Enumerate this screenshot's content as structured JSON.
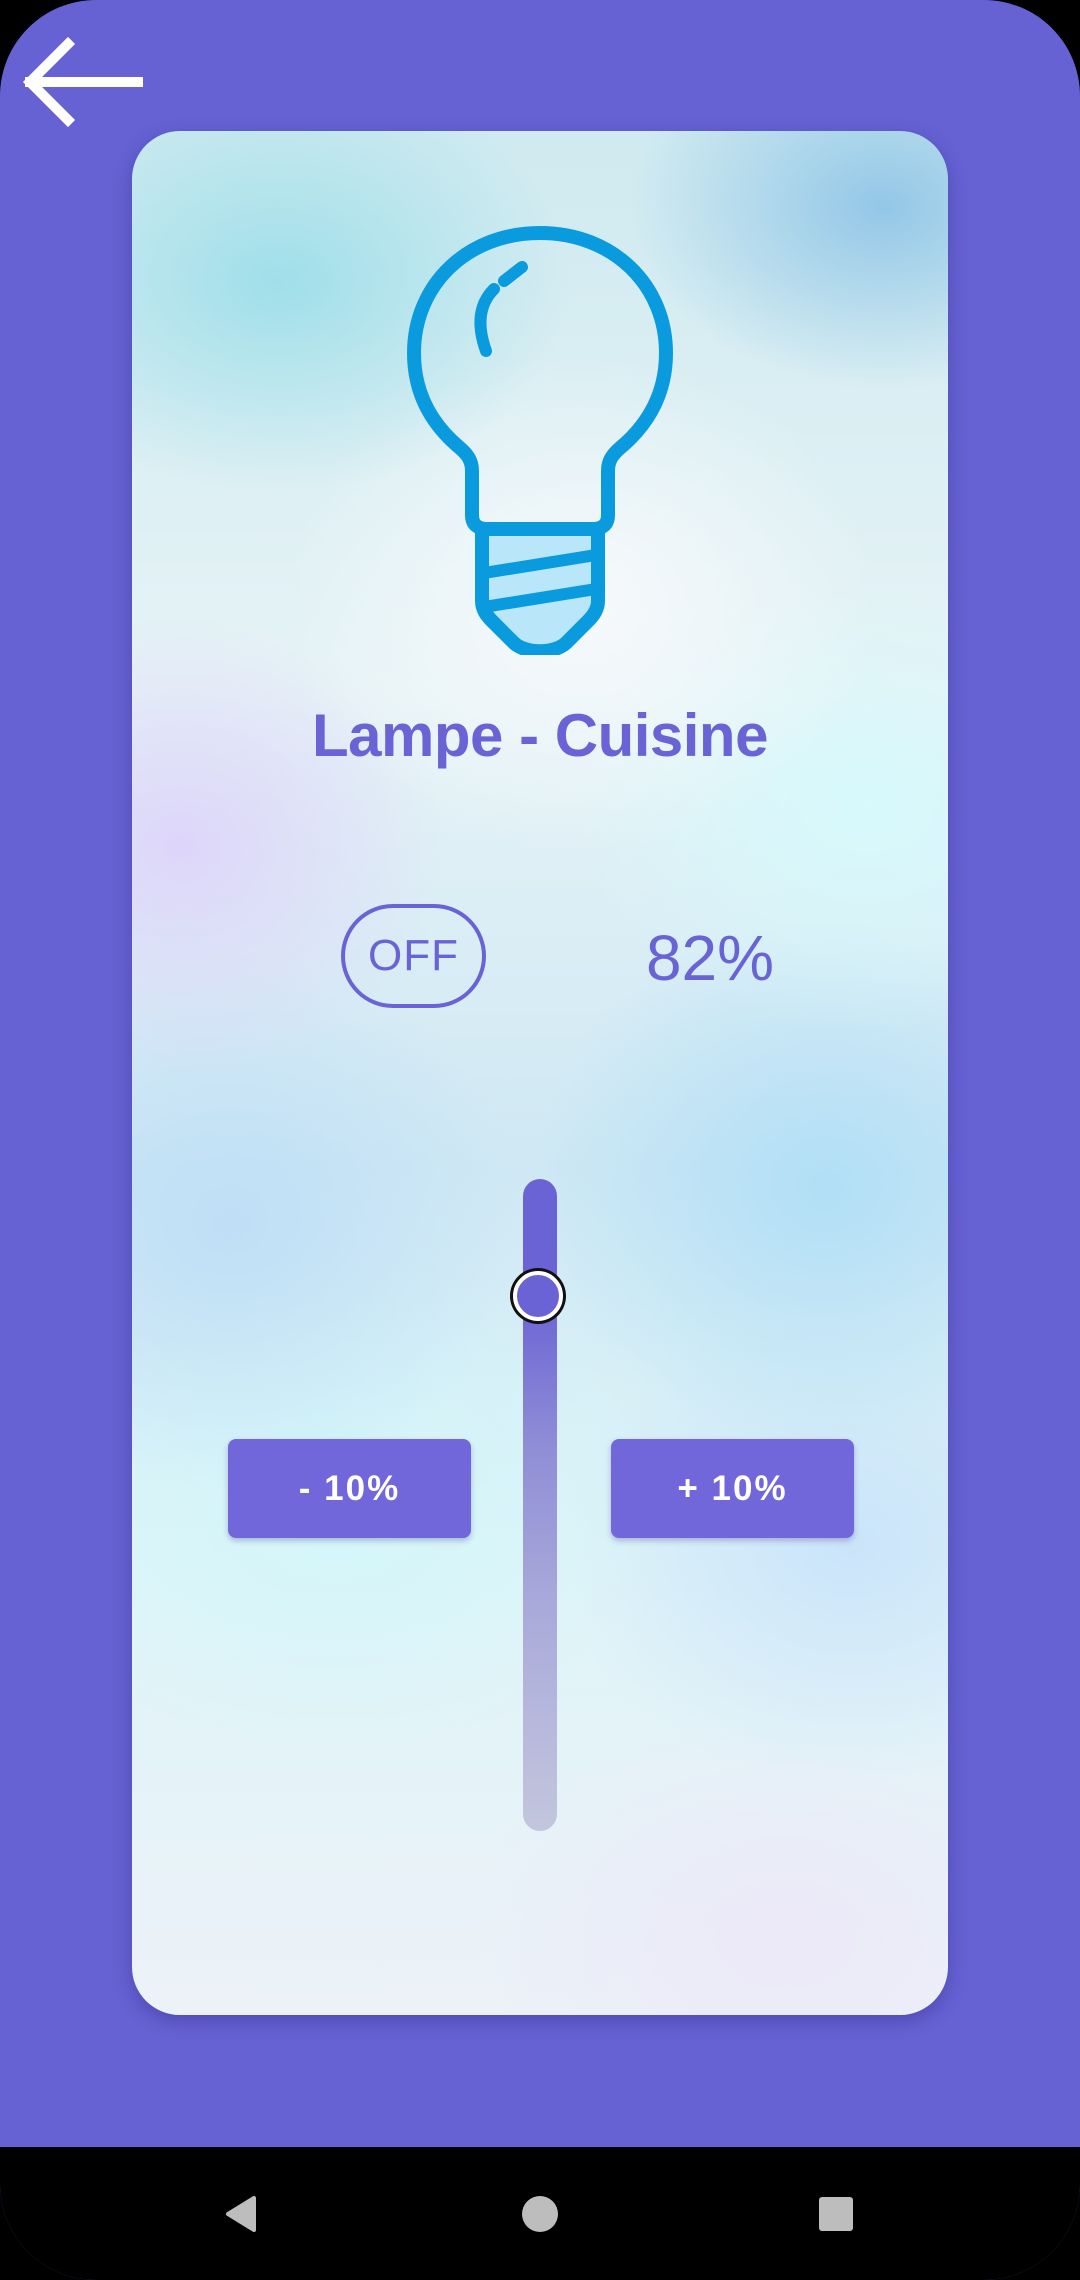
{
  "app": {
    "background_color": "#6662D3",
    "accent_color": "#6A63D5",
    "button_color": "#7266DB"
  },
  "header": {
    "back_icon": "arrow-left-icon"
  },
  "device": {
    "icon": "light-bulb-icon",
    "icon_color": "#0A9BDF",
    "name": "Lampe - Cuisine",
    "toggle_label": "OFF",
    "brightness_label": "82%",
    "brightness_level": 0.82
  },
  "controls": {
    "decrease_label": "- 10%",
    "increase_label": "+ 10%"
  },
  "system_nav": {
    "back_icon": "triangle-back-icon",
    "home_icon": "circle-home-icon",
    "recents_icon": "square-recents-icon"
  }
}
